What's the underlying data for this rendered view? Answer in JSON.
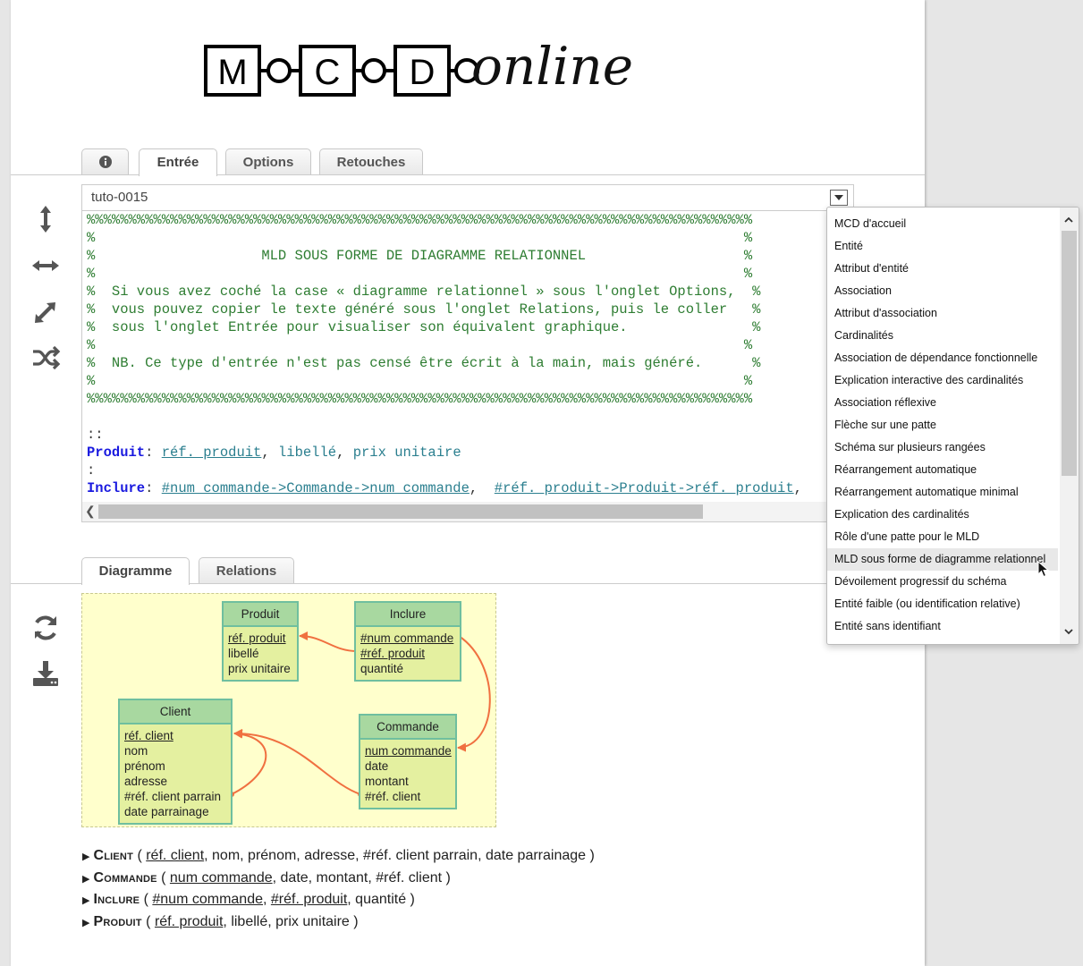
{
  "logo": {
    "text": "MCDonline",
    "letters": [
      "M",
      "C",
      "D"
    ],
    "script": "online"
  },
  "top_tabs": [
    {
      "label": "",
      "icon": "info-icon"
    },
    {
      "label": "Entrée",
      "active": true
    },
    {
      "label": "Options"
    },
    {
      "label": "Retouches"
    }
  ],
  "editor": {
    "selected": "tuto-0015",
    "lines": [
      {
        "parts": [
          {
            "t": "%%%%%%%%%%%%%%%%%%%%%%%%%%%%%%%%%%%%%%%%%%%%%%%%%%%%%%%%%%%%%%%%%%%%%%%%%%%%%%%%",
            "c": "cmt"
          }
        ]
      },
      {
        "parts": [
          {
            "t": "%                                                                              %",
            "c": "cmt"
          }
        ]
      },
      {
        "parts": [
          {
            "t": "%                    MLD SOUS FORME DE DIAGRAMME RELATIONNEL                   %",
            "c": "cmt"
          }
        ]
      },
      {
        "parts": [
          {
            "t": "%                                                                              %",
            "c": "cmt"
          }
        ]
      },
      {
        "parts": [
          {
            "t": "%  Si vous avez coché la case « diagramme relationnel » sous l'onglet Options,  %",
            "c": "cmt"
          }
        ]
      },
      {
        "parts": [
          {
            "t": "%  vous pouvez copier le texte généré sous l'onglet Relations, puis le coller   %",
            "c": "cmt"
          }
        ]
      },
      {
        "parts": [
          {
            "t": "%  sous l'onglet Entrée pour visualiser son équivalent graphique.               %",
            "c": "cmt"
          }
        ]
      },
      {
        "parts": [
          {
            "t": "%                                                                              %",
            "c": "cmt"
          }
        ]
      },
      {
        "parts": [
          {
            "t": "%  NB. Ce type d'entrée n'est pas censé être écrit à la main, mais généré.      %",
            "c": "cmt"
          }
        ]
      },
      {
        "parts": [
          {
            "t": "%                                                                              %",
            "c": "cmt"
          }
        ]
      },
      {
        "parts": [
          {
            "t": "%%%%%%%%%%%%%%%%%%%%%%%%%%%%%%%%%%%%%%%%%%%%%%%%%%%%%%%%%%%%%%%%%%%%%%%%%%%%%%%%",
            "c": "cmt"
          }
        ]
      },
      {
        "parts": [
          {
            "t": "",
            "c": "op"
          }
        ]
      },
      {
        "parts": [
          {
            "t": "::",
            "c": "op"
          }
        ]
      },
      {
        "parts": [
          {
            "t": "Produit",
            "c": "kw"
          },
          {
            "t": ": ",
            "c": "op"
          },
          {
            "t": "réf. produit",
            "c": "attr ul"
          },
          {
            "t": ", ",
            "c": "op"
          },
          {
            "t": "libellé",
            "c": "attr"
          },
          {
            "t": ", ",
            "c": "op"
          },
          {
            "t": "prix unitaire",
            "c": "attr"
          }
        ]
      },
      {
        "parts": [
          {
            "t": ":",
            "c": "op"
          }
        ]
      },
      {
        "parts": [
          {
            "t": "Inclure",
            "c": "kw"
          },
          {
            "t": ": ",
            "c": "op"
          },
          {
            "t": "#num commande->Commande->num commande",
            "c": "attr ul"
          },
          {
            "t": ",  ",
            "c": "op"
          },
          {
            "t": "#réf. produit->Produit->réf. produit",
            "c": "attr ul"
          },
          {
            "t": ",",
            "c": "op"
          }
        ]
      }
    ]
  },
  "dropdown_items": [
    "MCD d'accueil",
    "Entité",
    "Attribut d'entité",
    "Association",
    "Attribut d'association",
    "Cardinalités",
    "Association de dépendance fonctionnelle",
    "Explication interactive des cardinalités",
    "Association réflexive",
    "Flèche sur une patte",
    "Schéma sur plusieurs rangées",
    "Réarrangement automatique",
    "Réarrangement automatique minimal",
    "Explication des cardinalités",
    "Rôle d'une patte pour le MLD",
    "MLD sous forme de diagramme relationnel",
    "Dévoilement progressif du schéma",
    "Entité faible (ou identification relative)",
    "Entité sans identifiant"
  ],
  "dropdown_highlighted": "MLD sous forme de diagramme relationnel",
  "bottom_tabs": [
    {
      "label": "Diagramme",
      "active": true
    },
    {
      "label": "Relations"
    }
  ],
  "diagram": {
    "entities": [
      {
        "id": "produit",
        "title": "Produit",
        "attrs": [
          {
            "t": "réf. produit",
            "u": true
          },
          {
            "t": "libellé"
          },
          {
            "t": "prix unitaire"
          }
        ]
      },
      {
        "id": "inclure",
        "title": "Inclure",
        "attrs": [
          {
            "t": "#num commande",
            "u": true
          },
          {
            "t": "#réf. produit",
            "u": true
          },
          {
            "t": "quantité"
          }
        ]
      },
      {
        "id": "client",
        "title": "Client",
        "attrs": [
          {
            "t": "réf. client",
            "u": true
          },
          {
            "t": "nom"
          },
          {
            "t": "prénom"
          },
          {
            "t": "adresse"
          },
          {
            "t": "#réf. client parrain"
          },
          {
            "t": "date parrainage"
          }
        ]
      },
      {
        "id": "commande",
        "title": "Commande",
        "attrs": [
          {
            "t": "num commande",
            "u": true
          },
          {
            "t": "date"
          },
          {
            "t": "montant"
          },
          {
            "t": "#réf. client"
          }
        ]
      }
    ],
    "link_color": "#f07040"
  },
  "relations": [
    {
      "name": "Client",
      "attrs": [
        {
          "t": "réf. client",
          "u": true
        },
        {
          "t": "nom"
        },
        {
          "t": "prénom"
        },
        {
          "t": "adresse"
        },
        {
          "t": "#réf. client parrain"
        },
        {
          "t": "date parrainage"
        }
      ]
    },
    {
      "name": "Commande",
      "attrs": [
        {
          "t": "num commande",
          "u": true
        },
        {
          "t": "date"
        },
        {
          "t": "montant"
        },
        {
          "t": "#réf. client"
        }
      ]
    },
    {
      "name": "Inclure",
      "attrs": [
        {
          "t": "#num commande",
          "u": true
        },
        {
          "t": "#réf. produit",
          "u": true
        },
        {
          "t": "quantité"
        }
      ]
    },
    {
      "name": "Produit",
      "attrs": [
        {
          "t": "réf. produit",
          "u": true
        },
        {
          "t": "libellé"
        },
        {
          "t": "prix unitaire"
        }
      ]
    }
  ]
}
